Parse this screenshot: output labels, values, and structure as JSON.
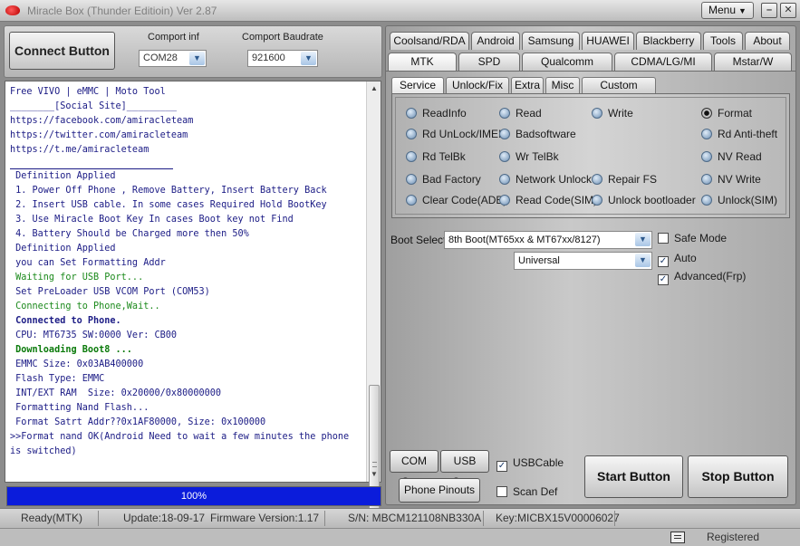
{
  "window": {
    "title": "Miracle Box (Thunder Editioin) Ver 2.87",
    "menu_label": "Menu",
    "minimize_glyph": "–",
    "close_glyph": "✕"
  },
  "connection": {
    "connect_label": "Connect Button",
    "comport_label": "Comport inf",
    "comport_value": "COM28",
    "baudrate_label": "Comport Baudrate",
    "baudrate_value": "921600"
  },
  "log": {
    "lines": [
      {
        "text": "Free VIVO | eMMC | Moto Tool",
        "style": ""
      },
      {
        "text": "________[Social Site]_________",
        "style": ""
      },
      {
        "text": "https://facebook.com/amiracleteam",
        "style": ""
      },
      {
        "text": "https://twitter.com/amiracleteam",
        "style": ""
      },
      {
        "text": "https://t.me/amiracleteam",
        "style": ""
      },
      {
        "text": " Definition Applied",
        "style": ""
      },
      {
        "text": " 1. Power Off Phone , Remove Battery, Insert Battery Back",
        "style": ""
      },
      {
        "text": " 2. Insert USB cable. In some cases Required Hold BootKey",
        "style": ""
      },
      {
        "text": " 3. Use Miracle Boot Key In cases Boot key not Find",
        "style": ""
      },
      {
        "text": " 4. Battery Should be Charged more then 50%",
        "style": ""
      },
      {
        "text": " Definition Applied",
        "style": ""
      },
      {
        "text": " you can Set Formatting Addr",
        "style": ""
      },
      {
        "text": " Waiting for USB Port...",
        "style": "green"
      },
      {
        "text": " Set PreLoader USB VCOM Port (COM53)",
        "style": ""
      },
      {
        "text": " Connecting to Phone,Wait..",
        "style": "green"
      },
      {
        "text": " Connected to Phone.",
        "style": "bold"
      },
      {
        "text": " CPU: MT6735 SW:0000 Ver: CB00",
        "style": ""
      },
      {
        "text": " Downloading Boot8 ...",
        "style": "darkgreen"
      },
      {
        "text": " EMMC Size: 0x03AB400000",
        "style": ""
      },
      {
        "text": " Flash Type: EMMC",
        "style": ""
      },
      {
        "text": " INT/EXT RAM  Size: 0x20000/0x80000000",
        "style": ""
      },
      {
        "text": " Formatting Nand Flash...",
        "style": ""
      },
      {
        "text": " Format Satrt Addr??0x1AF80000, Size: 0x100000",
        "style": ""
      },
      {
        "text": ">>Format nand OK(Android Need to wait a few minutes the phone is switched)",
        "style": "wrap"
      }
    ]
  },
  "progress": {
    "value": 1.0,
    "label": "100%",
    "color": "#0b1cdb"
  },
  "tabs": {
    "row1": [
      "Coolsand/RDA",
      "Android",
      "Samsung",
      "HUAWEI",
      "Blackberry",
      "Tools",
      "About"
    ],
    "row2": [
      "MTK",
      "SPD",
      "Qualcomm",
      "CDMA/LG/MI",
      "Mstar/W"
    ],
    "active": "MTK"
  },
  "subtabs": {
    "items": [
      "Service",
      "Unlock/Fix",
      "Extra",
      "Misc",
      "Custom Setting"
    ],
    "active": "Service"
  },
  "service_options": {
    "col1": [
      "ReadInfo",
      "Rd UnLock/IMEI",
      "Rd TelBk",
      "Bad Factory",
      "Clear Code(ADB)"
    ],
    "col2": [
      "Read",
      "Badsoftware",
      "Wr TelBk",
      "Network Unlock",
      "Read Code(SIM)"
    ],
    "col3": [
      "Write",
      "",
      "",
      "Repair FS",
      "Unlock bootloader"
    ],
    "col4": [
      "Format",
      "Rd Anti-theft",
      "NV Read",
      "NV Write",
      "Unlock(SIM)"
    ],
    "selected": "Format"
  },
  "boot": {
    "label": "Boot Select:",
    "value": "8th Boot(MT65xx & MT67xx/8127)",
    "second_value": "Universal"
  },
  "checks": {
    "safe_mode": {
      "label": "Safe Mode",
      "checked": false
    },
    "auto": {
      "label": "Auto",
      "checked": true
    },
    "advanced": {
      "label": "Advanced(Frp)",
      "checked": true
    },
    "usb_cable": {
      "label": "USBCable",
      "checked": true
    },
    "scan_def": {
      "label": "Scan Def",
      "checked": false
    }
  },
  "buttons": {
    "com_scan": "COM Scan",
    "usb_scan": "USB Scan",
    "phone_pinouts": "Phone Pinouts",
    "start": "Start Button",
    "stop": "Stop Button"
  },
  "status": {
    "ready": "Ready(MTK)",
    "update": "Update:18-09-17",
    "firmware": "Firmware Version:1.17",
    "serial": "S/N: MBCM121108NB330A",
    "key": "Key:MICBX15V00006027",
    "registered": "Registered"
  }
}
